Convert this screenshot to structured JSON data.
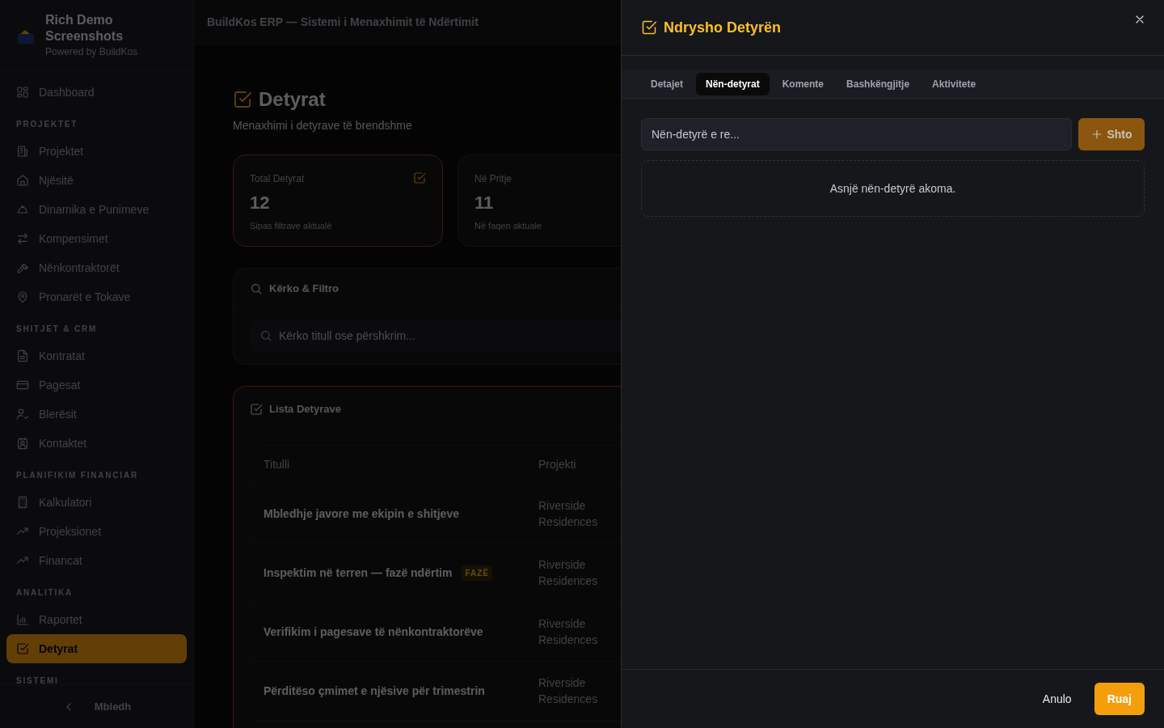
{
  "brand": {
    "name": "Rich Demo Screenshots",
    "tagline": "Powered by BuildKos"
  },
  "header_title": "BuildKos ERP — Sistemi i Menaxhimit të Ndërtimit",
  "sidebar": {
    "sections": [
      {
        "items": [
          {
            "label": "Dashboard",
            "selected": false
          }
        ]
      },
      {
        "label": "PROJEKTET",
        "items": [
          {
            "label": "Projektet",
            "selected": false
          },
          {
            "label": "Njësitë",
            "selected": false
          },
          {
            "label": "Dinamika e Punimeve",
            "selected": false
          },
          {
            "label": "Kompensimet",
            "selected": false
          },
          {
            "label": "Nënkontraktorët",
            "selected": false
          },
          {
            "label": "Pronarët e Tokave",
            "selected": false
          }
        ]
      },
      {
        "label": "SHITJET & CRM",
        "items": [
          {
            "label": "Kontratat",
            "selected": false
          },
          {
            "label": "Pagesat",
            "selected": false
          },
          {
            "label": "Blerësit",
            "selected": false
          },
          {
            "label": "Kontaktet",
            "selected": false
          }
        ]
      },
      {
        "label": "PLANIFIKIM FINANCIAR",
        "items": [
          {
            "label": "Kalkulatori",
            "selected": false
          },
          {
            "label": "Projeksionet",
            "selected": false
          },
          {
            "label": "Financat",
            "selected": false
          }
        ]
      },
      {
        "label": "ANALITIKA",
        "items": [
          {
            "label": "Raportet",
            "selected": false
          },
          {
            "label": "Detyrat",
            "selected": true
          }
        ]
      },
      {
        "label": "SISTEMI"
      }
    ],
    "collapse_label": "Mbledh"
  },
  "page": {
    "title": "Detyrat",
    "subtitle": "Menaxhimi i detyrave të brendshme",
    "stats": [
      {
        "label": "Total Detyrat",
        "value": "12",
        "note": "Sipas filtrave aktualë"
      },
      {
        "label": "Në Pritje",
        "value": "11",
        "note": "Në faqen aktuale"
      }
    ],
    "filter": {
      "title": "Kërko & Filtro",
      "search_placeholder": "Kërko titull ose përshkrim..."
    },
    "list": {
      "title": "Lista Detyrave",
      "columns": [
        "Titulli",
        "Projekti"
      ],
      "rows": [
        {
          "title": "Mbledhje javore me ekipin e shitjeve",
          "project": "Riverside Residences"
        },
        {
          "title": "Inspektim në terren — fazë ndërtim",
          "badge": "FAZË",
          "project": "Riverside Residences"
        },
        {
          "title": "Verifikim i pagesave të nënkontraktorëve",
          "project": "Riverside Residences"
        },
        {
          "title": "Përditëso çmimet e njësive për trimestrin",
          "project": "Riverside Residences"
        }
      ]
    }
  },
  "dialog": {
    "title": "Ndrysho Detyrën",
    "tabs": [
      {
        "label": "Detajet",
        "selected": false
      },
      {
        "label": "Nën-detyrat",
        "selected": true
      },
      {
        "label": "Komente",
        "selected": false
      },
      {
        "label": "Bashkëngjitje",
        "selected": false
      },
      {
        "label": "Aktivitete",
        "selected": false
      }
    ],
    "subtask_placeholder": "Nën-detyrë e re...",
    "add_label": "Shto",
    "empty_text": "Asnjë nën-detyrë akoma.",
    "cancel": "Anulo",
    "save": "Ruaj"
  }
}
